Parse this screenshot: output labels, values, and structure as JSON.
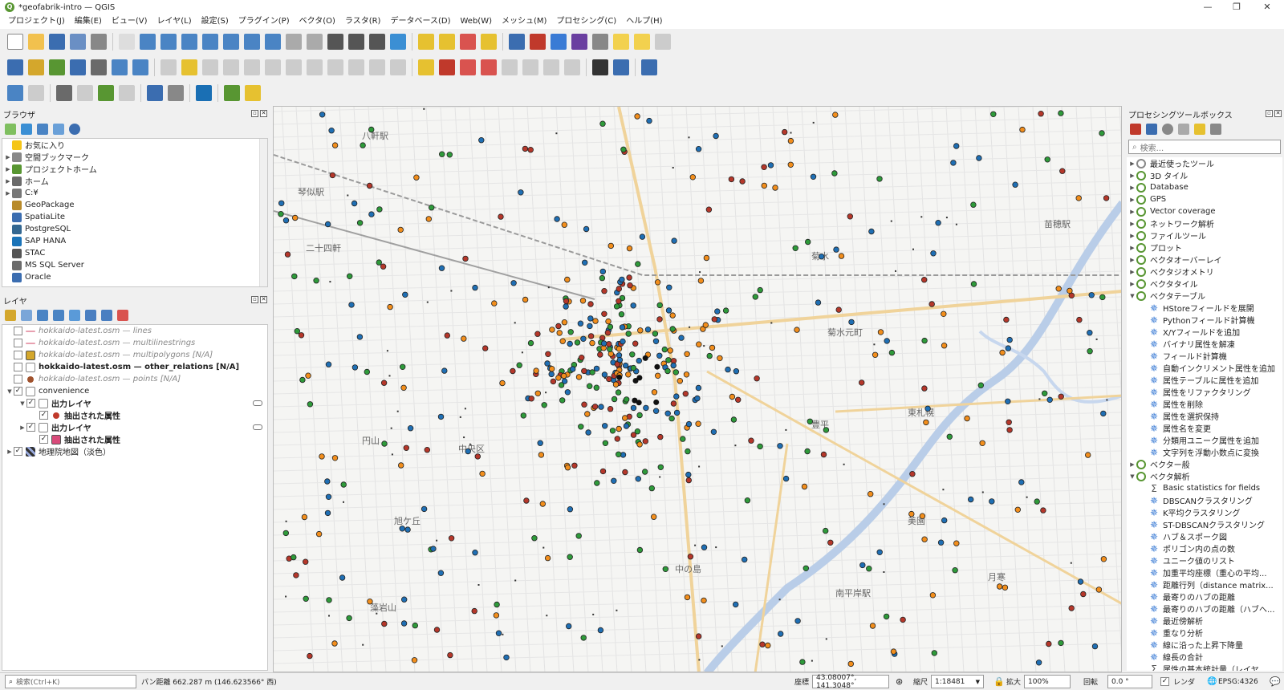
{
  "window": {
    "title": "*geofabrik-intro — QGIS",
    "logo_letter": "Q"
  },
  "menu": [
    "プロジェクト(J)",
    "編集(E)",
    "ビュー(V)",
    "レイヤ(L)",
    "設定(S)",
    "プラグイン(P)",
    "ベクタ(O)",
    "ラスタ(R)",
    "データベース(D)",
    "Web(W)",
    "メッシュ(M)",
    "プロセシング(C)",
    "ヘルプ(H)"
  ],
  "browser": {
    "title": "ブラウザ",
    "items": [
      {
        "label": "お気に入り",
        "icon": "star-icon",
        "color": "#f5c518",
        "arrow": ""
      },
      {
        "label": "空間ブックマーク",
        "icon": "bookmark-icon",
        "color": "#888",
        "arrow": "▶"
      },
      {
        "label": "プロジェクトホーム",
        "icon": "project-home-icon",
        "color": "#589632",
        "arrow": "▶"
      },
      {
        "label": "ホーム",
        "icon": "home-folder-icon",
        "color": "#6a6a6a",
        "arrow": "▶"
      },
      {
        "label": "C:¥",
        "icon": "drive-icon",
        "color": "#777",
        "arrow": "▶"
      },
      {
        "label": "GeoPackage",
        "icon": "geopackage-icon",
        "color": "#b88a2a",
        "arrow": ""
      },
      {
        "label": "SpatiaLite",
        "icon": "spatialite-icon",
        "color": "#3b6db0",
        "arrow": ""
      },
      {
        "label": "PostgreSQL",
        "icon": "postgresql-icon",
        "color": "#336791",
        "arrow": ""
      },
      {
        "label": "SAP HANA",
        "icon": "sap-hana-icon",
        "color": "#1a73b8",
        "arrow": ""
      },
      {
        "label": "STAC",
        "icon": "stac-icon",
        "color": "#555",
        "arrow": ""
      },
      {
        "label": "MS SQL Server",
        "icon": "mssql-icon",
        "color": "#6b6b6b",
        "arrow": ""
      },
      {
        "label": "Oracle",
        "icon": "oracle-icon",
        "color": "#3b6db0",
        "arrow": ""
      }
    ]
  },
  "layers": {
    "title": "レイヤ",
    "items": [
      {
        "label": "hokkaido-latest.osm — lines",
        "style": "grey",
        "swatch": "line",
        "color": "#e8a0b0",
        "checked": false,
        "indent": 0,
        "arrow": ""
      },
      {
        "label": "hokkaido-latest.osm — multilinestrings",
        "style": "grey",
        "swatch": "line",
        "color": "#e8a0b0",
        "checked": false,
        "indent": 0,
        "arrow": ""
      },
      {
        "label": "hokkaido-latest.osm — multipolygons [N/A]",
        "style": "grey",
        "swatch": "box",
        "color": "#d4a72c",
        "checked": false,
        "indent": 0,
        "arrow": ""
      },
      {
        "label": "hokkaido-latest.osm — other_relations [N/A]",
        "style": "bold",
        "swatch": "table",
        "color": "#888",
        "checked": false,
        "indent": 0,
        "arrow": ""
      },
      {
        "label": "hokkaido-latest.osm — points [N/A]",
        "style": "grey",
        "swatch": "dot",
        "color": "#a0522d",
        "checked": false,
        "indent": 0,
        "arrow": ""
      },
      {
        "label": "convenience",
        "style": "",
        "swatch": "group",
        "color": "#888",
        "checked": true,
        "indent": 0,
        "arrow": "▼"
      },
      {
        "label": "出力レイヤ",
        "style": "bold",
        "swatch": "group",
        "color": "#888",
        "checked": true,
        "indent": 1,
        "arrow": "▼"
      },
      {
        "label": "抽出された属性",
        "style": "bold",
        "swatch": "dot",
        "color": "#c0392b",
        "checked": true,
        "indent": 2,
        "arrow": ""
      },
      {
        "label": "出力レイヤ",
        "style": "bold",
        "swatch": "group",
        "color": "#888",
        "checked": true,
        "indent": 1,
        "arrow": "▶"
      },
      {
        "label": "抽出された属性",
        "style": "bold",
        "swatch": "box",
        "color": "#d94a7a",
        "checked": true,
        "indent": 2,
        "arrow": ""
      },
      {
        "label": "地理院地図（淡色）",
        "style": "",
        "swatch": "raster",
        "color": "#333",
        "checked": true,
        "indent": 0,
        "arrow": "▶"
      }
    ]
  },
  "processing": {
    "title": "プロセシングツールボックス",
    "search_placeholder": "検索...",
    "items": [
      {
        "label": "最近使ったツール",
        "type": "clock",
        "arrow": "▶",
        "indent": 0
      },
      {
        "label": "3D タイル",
        "type": "group",
        "arrow": "▶",
        "indent": 0
      },
      {
        "label": "Database",
        "type": "group",
        "arrow": "▶",
        "indent": 0
      },
      {
        "label": "GPS",
        "type": "group",
        "arrow": "▶",
        "indent": 0
      },
      {
        "label": "Vector coverage",
        "type": "group",
        "arrow": "▶",
        "indent": 0
      },
      {
        "label": "ネットワーク解析",
        "type": "group",
        "arrow": "▶",
        "indent": 0
      },
      {
        "label": "ファイルツール",
        "type": "group",
        "arrow": "▶",
        "indent": 0
      },
      {
        "label": "プロット",
        "type": "group",
        "arrow": "▶",
        "indent": 0
      },
      {
        "label": "ベクタオーバーレイ",
        "type": "group",
        "arrow": "▶",
        "indent": 0
      },
      {
        "label": "ベクタジオメトリ",
        "type": "group",
        "arrow": "▶",
        "indent": 0
      },
      {
        "label": "ベクタタイル",
        "type": "group",
        "arrow": "▶",
        "indent": 0
      },
      {
        "label": "ベクタテーブル",
        "type": "group",
        "arrow": "▼",
        "indent": 0
      },
      {
        "label": "HStoreフィールドを展開",
        "type": "tool",
        "arrow": "",
        "indent": 1
      },
      {
        "label": "Pythonフィールド計算機",
        "type": "tool",
        "arrow": "",
        "indent": 1
      },
      {
        "label": "X/Yフィールドを追加",
        "type": "tool",
        "arrow": "",
        "indent": 1
      },
      {
        "label": "バイナリ属性を解凍",
        "type": "tool",
        "arrow": "",
        "indent": 1
      },
      {
        "label": "フィールド計算機",
        "type": "tool",
        "arrow": "",
        "indent": 1
      },
      {
        "label": "自動インクリメント属性を追加",
        "type": "tool",
        "arrow": "",
        "indent": 1
      },
      {
        "label": "属性テーブルに属性を追加",
        "type": "tool",
        "arrow": "",
        "indent": 1
      },
      {
        "label": "属性をリファクタリング",
        "type": "tool",
        "arrow": "",
        "indent": 1
      },
      {
        "label": "属性を削除",
        "type": "tool",
        "arrow": "",
        "indent": 1
      },
      {
        "label": "属性を選択保持",
        "type": "tool",
        "arrow": "",
        "indent": 1
      },
      {
        "label": "属性名を変更",
        "type": "tool",
        "arrow": "",
        "indent": 1
      },
      {
        "label": "分類用ユニーク属性を追加",
        "type": "tool",
        "arrow": "",
        "indent": 1
      },
      {
        "label": "文字列を浮動小数点に変換",
        "type": "tool",
        "arrow": "",
        "indent": 1
      },
      {
        "label": "ベクター般",
        "type": "group",
        "arrow": "▶",
        "indent": 0
      },
      {
        "label": "ベクタ解析",
        "type": "group",
        "arrow": "▼",
        "indent": 0
      },
      {
        "label": "Basic statistics for fields",
        "type": "sigma",
        "arrow": "",
        "indent": 1
      },
      {
        "label": "DBSCANクラスタリング",
        "type": "tool",
        "arrow": "",
        "indent": 1
      },
      {
        "label": "K平均クラスタリング",
        "type": "tool",
        "arrow": "",
        "indent": 1
      },
      {
        "label": "ST-DBSCANクラスタリング",
        "type": "tool",
        "arrow": "",
        "indent": 1
      },
      {
        "label": "ハブ＆スポーク図",
        "type": "tool",
        "arrow": "",
        "indent": 1
      },
      {
        "label": "ポリゴン内の点の数",
        "type": "tool",
        "arrow": "",
        "indent": 1
      },
      {
        "label": "ユニーク値のリスト",
        "type": "tool",
        "arrow": "",
        "indent": 1
      },
      {
        "label": "加重平均座標（重心の平均...",
        "type": "tool",
        "arrow": "",
        "indent": 1
      },
      {
        "label": "距離行列（distance matrix...",
        "type": "tool",
        "arrow": "",
        "indent": 1
      },
      {
        "label": "最寄りのハブの距離",
        "type": "tool",
        "arrow": "",
        "indent": 1
      },
      {
        "label": "最寄りのハブの距離（ハブへ...",
        "type": "tool",
        "arrow": "",
        "indent": 1
      },
      {
        "label": "最近傍解析",
        "type": "tool",
        "arrow": "",
        "indent": 1
      },
      {
        "label": "重なり分析",
        "type": "tool",
        "arrow": "",
        "indent": 1
      },
      {
        "label": "線に沿った上昇下降量",
        "type": "tool",
        "arrow": "",
        "indent": 1
      },
      {
        "label": "線長の合計",
        "type": "tool",
        "arrow": "",
        "indent": 1
      },
      {
        "label": "属性の基本統計量（レイヤ...",
        "type": "sigma",
        "arrow": "",
        "indent": 1
      }
    ]
  },
  "map": {
    "labels": [
      "八軒駅",
      "琴似駅",
      "二十四軒",
      "円山",
      "中央区",
      "旭ケ丘",
      "藻岩山",
      "菊水",
      "菊水元町",
      "豊平",
      "東札幌",
      "南平岸駅",
      "美園",
      "月寒",
      "苗穂駅",
      "中の島"
    ],
    "colors": {
      "blue": "#1f6fb4",
      "orange": "#f28e1c",
      "red": "#b5372a",
      "green": "#2e9a3a",
      "black": "#111111"
    },
    "point_count": 520
  },
  "status": {
    "search_placeholder": "検索(Ctrl+K)",
    "message": "パン距離 662.287 m (146.623566° 西)",
    "coord_label": "座標",
    "coord_value": "43.08007°, 141.3048°",
    "scale_label": "縮尺",
    "scale_value": "1:18481",
    "magnifier_label": "拡大",
    "magnifier_value": "100%",
    "rotation_label": "回転",
    "rotation_value": "0.0 °",
    "render_label": "レンダ",
    "crs": "EPSG:4326"
  }
}
